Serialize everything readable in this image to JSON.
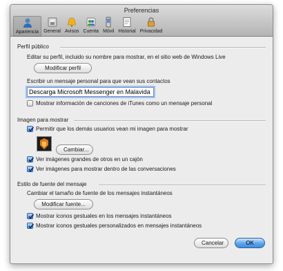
{
  "window": {
    "title": "Preferencias"
  },
  "toolbar": {
    "items": [
      {
        "label": "Apariencia",
        "icon": "person-icon",
        "active": true
      },
      {
        "label": "General",
        "icon": "switch-icon"
      },
      {
        "label": "Avisos",
        "icon": "bell-icon"
      },
      {
        "label": "Cuenta",
        "icon": "account-icon"
      },
      {
        "label": "Móvil",
        "icon": "phone-icon"
      },
      {
        "label": "Historial",
        "icon": "history-icon"
      },
      {
        "label": "Privacidad",
        "icon": "lock-icon"
      }
    ]
  },
  "perfil": {
    "title": "Perfil público",
    "desc": "Editar su perfil, incluido su nombre para mostrar, en el sitio web de Windows Live",
    "edit_button": "Modificar perfil",
    "message_label": "Escribir un mensaje personal para que vean sus contactos",
    "message_value": "Descarga Microsoft Messenger en Malavida",
    "itunes_label": "Mostrar información de canciones de iTunes como un mensaje personal",
    "itunes_checked": false
  },
  "imagen": {
    "title": "Imagen para mostrar",
    "allow_label": "Permitir que los demás usuarios vean mi imagen para mostrar",
    "allow_checked": true,
    "change_button": "Cambiar...",
    "large_label": "Ver imágenes grandes de otros en un cajón",
    "large_checked": true,
    "conv_label": "Ver imágenes para mostrar dentro de las conversaciones",
    "conv_checked": true
  },
  "fuente": {
    "title": "Estilo de fuente del mensaje",
    "size_label": "Cambiar el tamaño de fuente de los mensajes instantáneos",
    "font_button": "Modificar fuente...",
    "gest_label": "Mostrar iconos gestuales en los mensajes instantáneos",
    "gest_checked": true,
    "gest_custom_label": "Mostrar iconos gestuales personalizados en mensajes instantáneos",
    "gest_custom_checked": true
  },
  "footer": {
    "cancel": "Cancelar",
    "ok": "OK"
  },
  "colors": {
    "ok_button": "#3f8de0",
    "checkbox_on": "#4d94e0",
    "window_bg": "#ececec"
  }
}
